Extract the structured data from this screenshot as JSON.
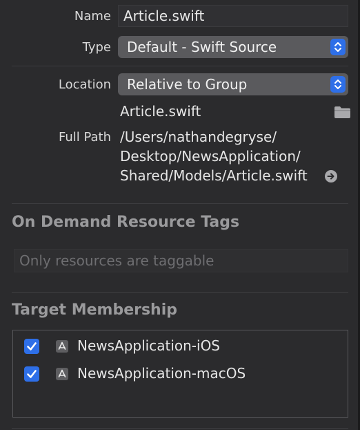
{
  "identity": {
    "name_label": "Name",
    "name_value": "Article.swift",
    "type_label": "Type",
    "type_value": "Default - Swift Source"
  },
  "location": {
    "location_label": "Location",
    "location_value": "Relative to Group",
    "file_name": "Article.swift",
    "full_path_label": "Full Path",
    "full_path_lines": [
      "/Users/nathandegryse/",
      "Desktop/NewsApplication/",
      "Shared/Models/Article.swift"
    ],
    "folder_icon": "folder-icon",
    "reveal_icon": "arrow-right-circle-icon"
  },
  "on_demand": {
    "title": "On Demand Resource Tags",
    "placeholder": "Only resources are taggable"
  },
  "target_membership": {
    "title": "Target Membership",
    "targets": [
      {
        "label": "NewsApplication-iOS",
        "checked": true,
        "icon": "app-target-icon"
      },
      {
        "label": "NewsApplication-macOS",
        "checked": true,
        "icon": "app-target-icon"
      }
    ]
  },
  "colors": {
    "background": "#2b2b2d",
    "accent": "#2e6fe8",
    "popup": "#5a5a5d",
    "section_title": "#9a9a9c"
  }
}
